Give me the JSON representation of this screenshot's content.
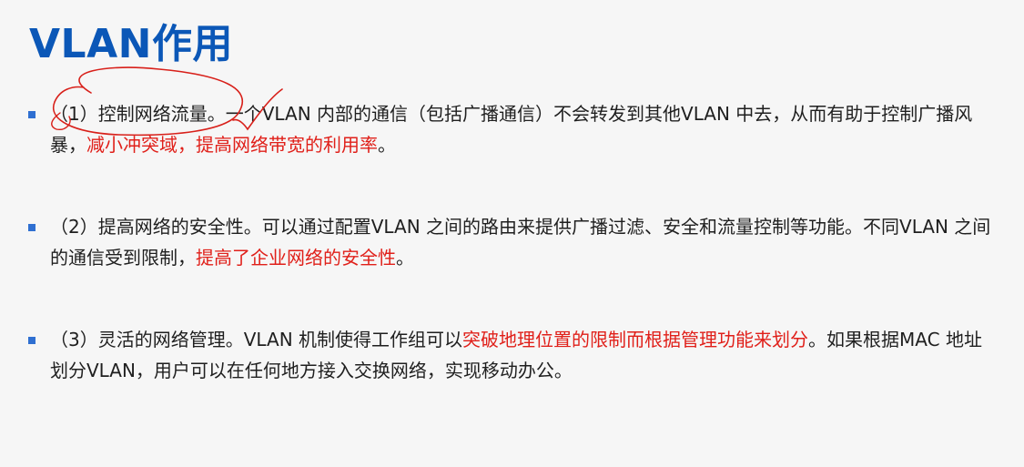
{
  "title": "VLAN作用",
  "bullets": [
    {
      "lead": "（1）控制网络流量。",
      "body": "一个VLAN 内部的通信（包括广播通信）不会转发到其他VLAN 中去，从而有助于控制广播风暴，",
      "highlight": "减小冲突域，提高网络带宽的利用率",
      "tail": "。"
    },
    {
      "lead": "（2）提高网络的安全性。",
      "body": "可以通过配置VLAN 之间的路由来提供广播过滤、安全和流量控制等功能。不同VLAN 之间的通信受到限制，",
      "highlight": "提高了企业网络的安全性",
      "tail": "。"
    },
    {
      "lead": "（3）灵活的网络管理。",
      "body": "VLAN 机制使得工作组可以",
      "highlight": "突破地理位置的限制而根据管理功能来划分",
      "tail": "。如果根据MAC 地址划分VLAN，用户可以在任何地方接入交换网络，实现移动办公。"
    }
  ],
  "colors": {
    "title": "#0b57b7",
    "marker": "#2f6fd1",
    "highlight": "#e0201a",
    "ink_annotation": "#d8201a"
  }
}
